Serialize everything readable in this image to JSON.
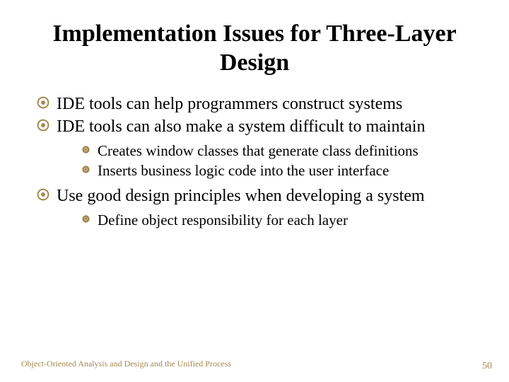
{
  "title": "Implementation Issues for Three-Layer Design",
  "bullets": [
    {
      "text": "IDE tools can help programmers construct systems"
    },
    {
      "text": "IDE tools can also make a system difficult to maintain",
      "sub": [
        {
          "text": "Creates window classes that generate class definitions"
        },
        {
          "text": "Inserts business logic code into the user interface"
        }
      ]
    },
    {
      "text": "Use good design principles when developing a system",
      "sub": [
        {
          "text": "Define object responsibility for each layer"
        }
      ]
    }
  ],
  "footer": "Object-Oriented Analysis and Design and the Unified Process",
  "page": "50"
}
